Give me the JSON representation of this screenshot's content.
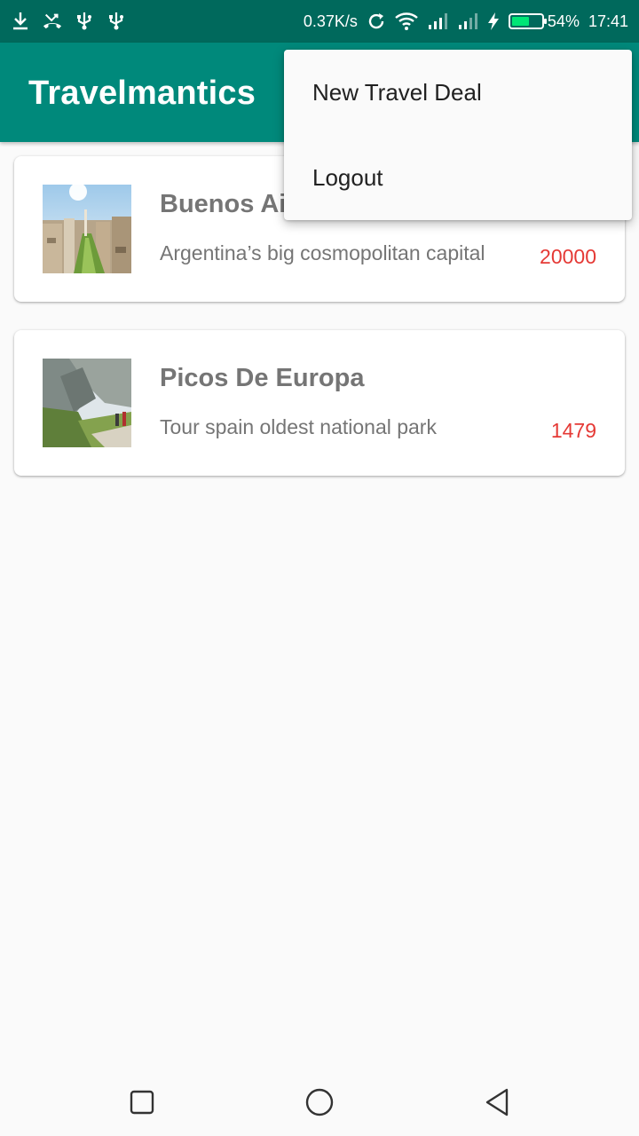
{
  "status_bar": {
    "speed": "0.37K/s",
    "battery_percent_label": "54%",
    "battery_level": 0.54,
    "time": "17:41",
    "left_icons": [
      "download-icon",
      "missed-call-icon",
      "usb-icon",
      "usb-icon"
    ],
    "right_icons": [
      "sync-icon",
      "wifi-icon",
      "signal-icon",
      "signal-icon",
      "charging-icon",
      "battery-icon"
    ]
  },
  "app_bar": {
    "title": "Travelmantics",
    "color": "#00897b",
    "status_color": "#00695c"
  },
  "deals": [
    {
      "title": "Buenos Aires",
      "description": "Argentina’s big cosmopolitan capital",
      "price": "20000",
      "image": "city-photo"
    },
    {
      "title": "Picos De Europa",
      "description": "Tour spain oldest national park",
      "price": "1479",
      "image": "mountain-photo"
    }
  ],
  "overflow_menu": {
    "items": [
      "New Travel Deal",
      "Logout"
    ]
  },
  "nav_bar": {
    "icons": [
      "recents-icon",
      "home-icon",
      "back-icon"
    ]
  },
  "colors": {
    "price": "#e53935",
    "text_secondary": "#757575"
  }
}
